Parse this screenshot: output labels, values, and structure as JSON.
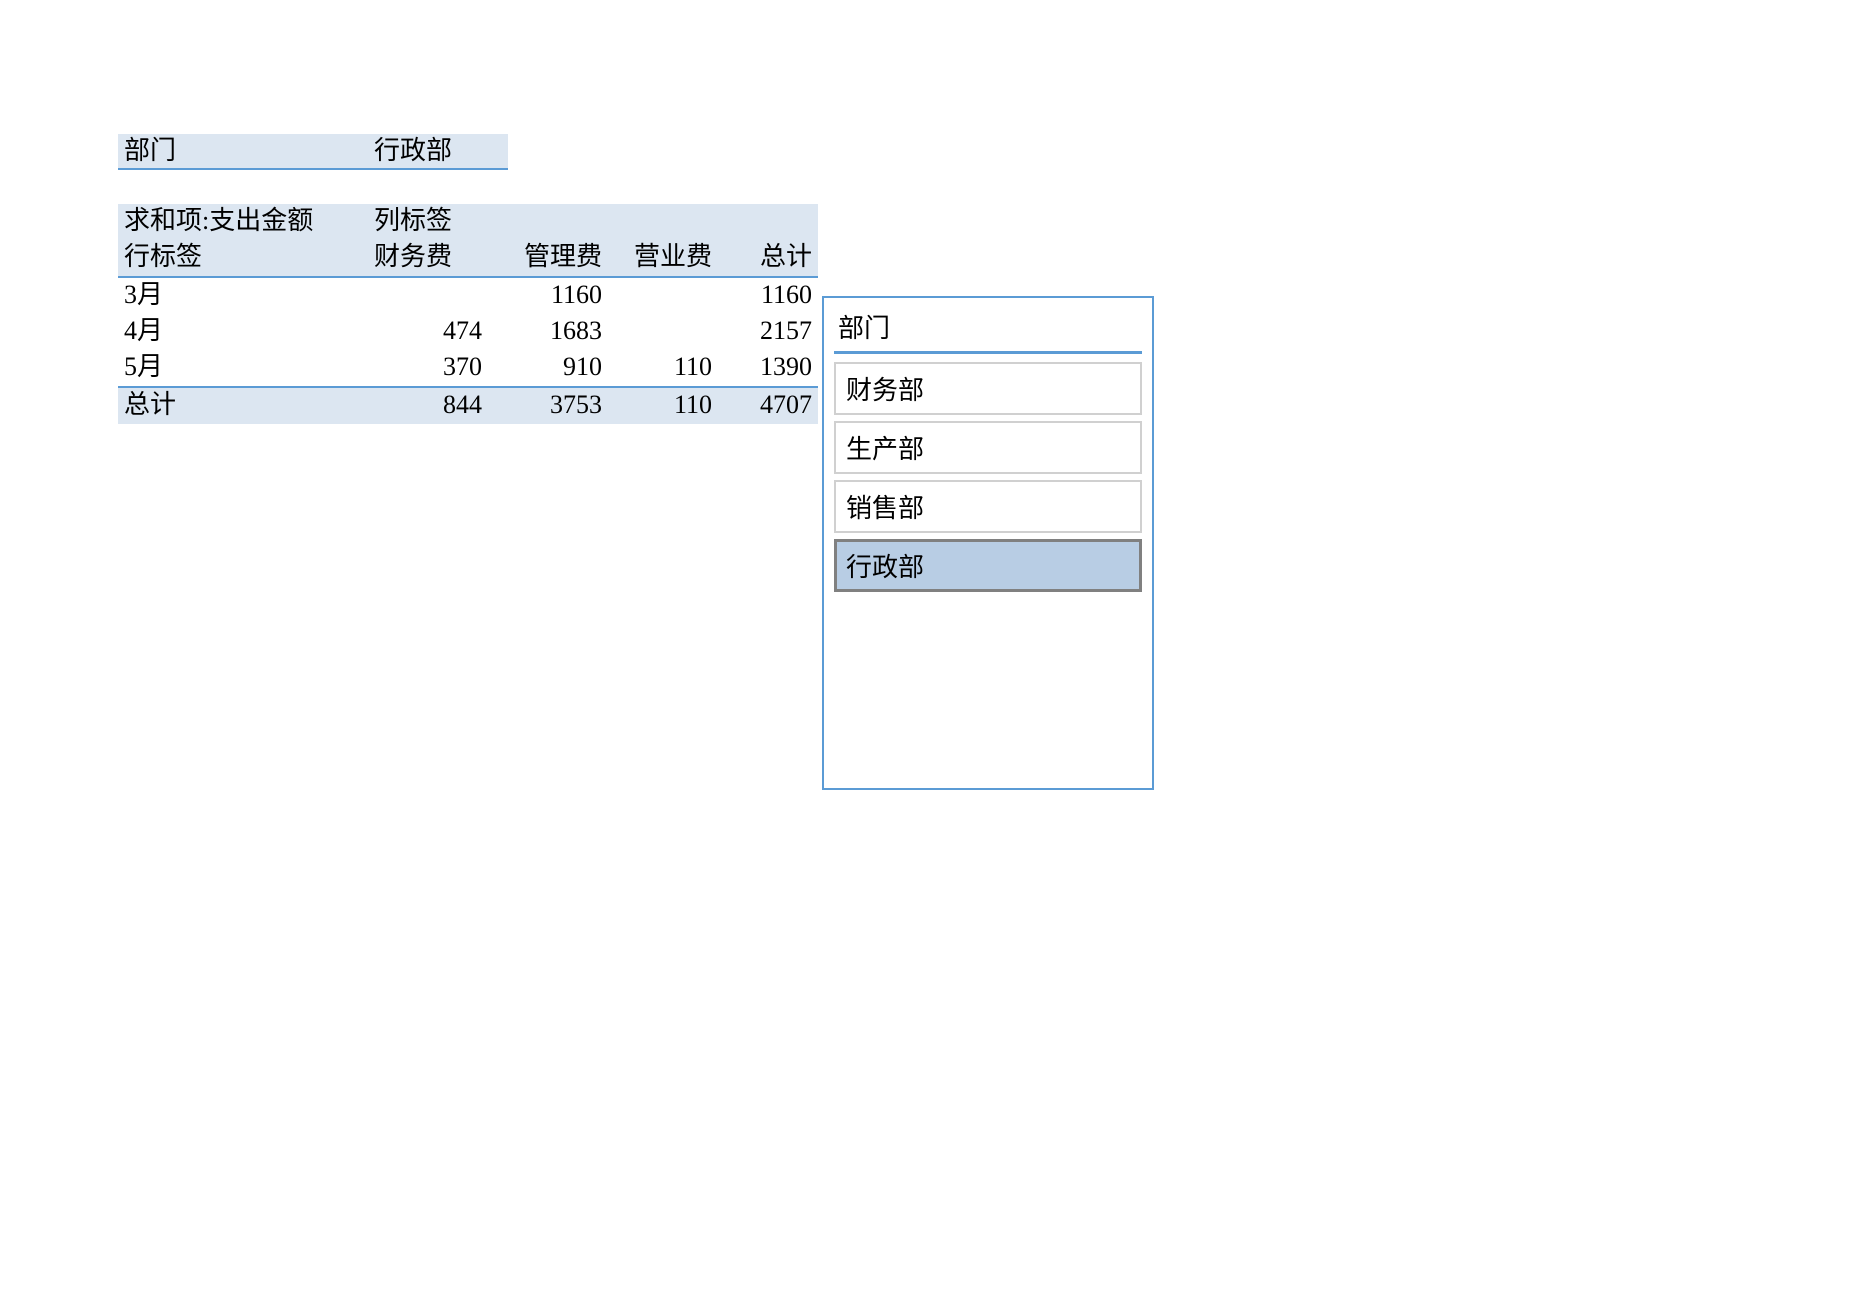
{
  "filter": {
    "label": "部门",
    "value": "行政部"
  },
  "pivot": {
    "value_field_label": "求和项:支出金额",
    "column_label_header": "列标签",
    "row_label_header": "行标签",
    "columns": [
      "财务费",
      "管理费",
      "营业费",
      "总计"
    ],
    "rows": [
      {
        "label": "3月",
        "values": [
          "",
          "1160",
          "",
          "1160"
        ]
      },
      {
        "label": "4月",
        "values": [
          "474",
          "1683",
          "",
          "2157"
        ]
      },
      {
        "label": "5月",
        "values": [
          "370",
          "910",
          "110",
          "1390"
        ]
      }
    ],
    "total": {
      "label": "总计",
      "values": [
        "844",
        "3753",
        "110",
        "4707"
      ]
    }
  },
  "slicer": {
    "title": "部门",
    "items": [
      {
        "label": "财务部",
        "selected": false
      },
      {
        "label": "生产部",
        "selected": false
      },
      {
        "label": "销售部",
        "selected": false
      },
      {
        "label": "行政部",
        "selected": true
      }
    ]
  }
}
